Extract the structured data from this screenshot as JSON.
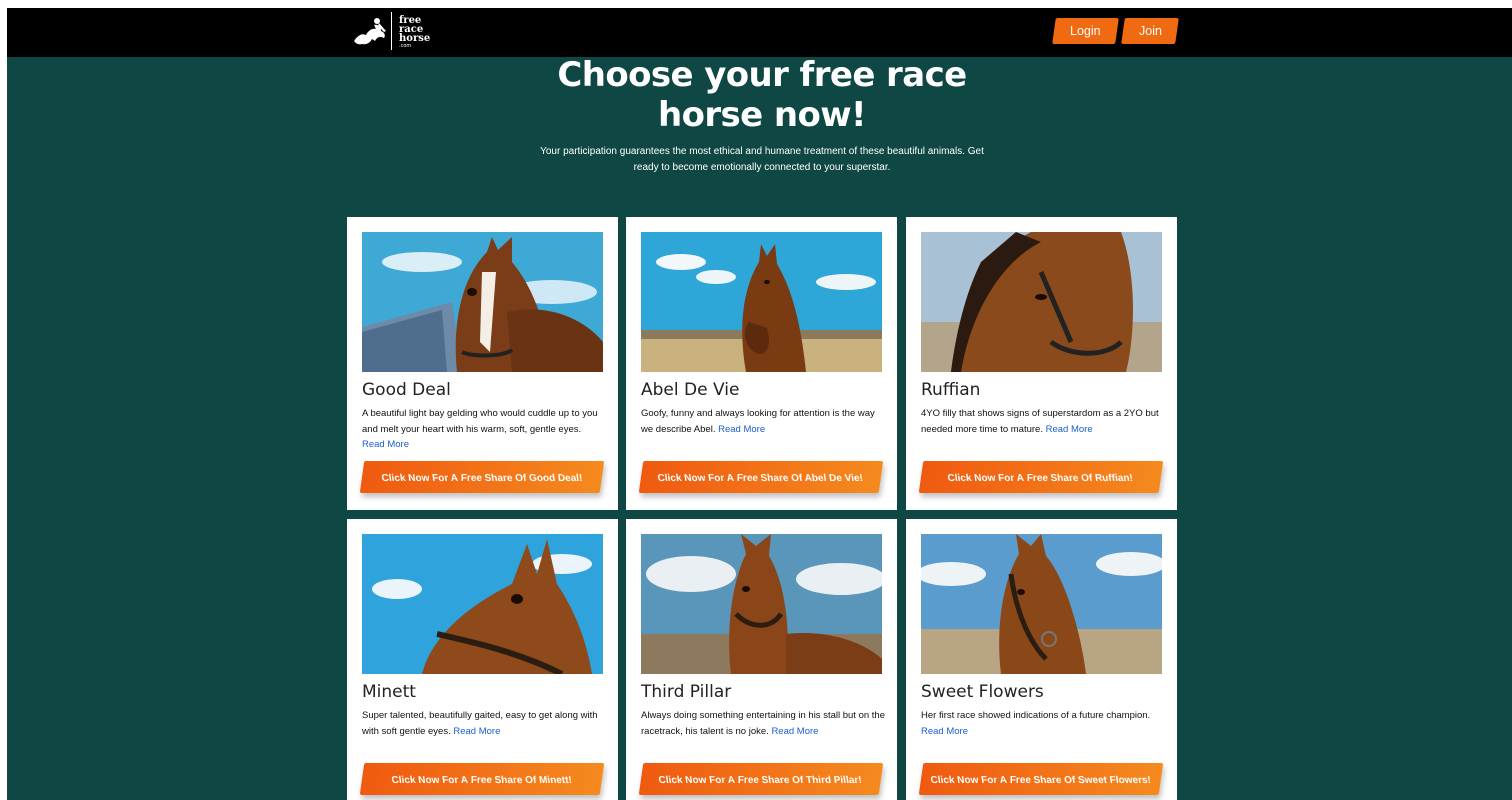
{
  "brand": {
    "logo_lines": [
      "free",
      "race",
      "horse"
    ],
    "logo_domain": ".com"
  },
  "nav": {
    "login_label": "Login",
    "join_label": "Join"
  },
  "hero": {
    "title": "Choose your free race horse now!",
    "subtitle": "Your participation guarantees the most ethical and humane treatment of these beautiful animals. Get ready to become emotionally connected to your superstar."
  },
  "cards": [
    {
      "name": "Good Deal",
      "desc": "A beautiful light bay gelding who would cuddle up to you and melt your heart with his warm, soft, gentle eyes.",
      "read_more": "Read More",
      "cta_prefix": "Click Now For A",
      "cta_bold": "Free",
      "cta_suffix": "Share Of Good Deal!"
    },
    {
      "name": "Abel De Vie",
      "desc": "Goofy, funny and always looking for attention is the way we describe Abel.",
      "read_more": "Read More",
      "cta_prefix": "Click Now For A",
      "cta_bold": "Free",
      "cta_suffix": "Share Of Abel De Vie!"
    },
    {
      "name": "Ruffian",
      "desc": "4YO filly that shows signs of superstardom as a 2YO but needed more time to mature.",
      "read_more": "Read More",
      "cta_prefix": "Click Now For A",
      "cta_bold": "Free",
      "cta_suffix": "Share Of Ruffian!"
    },
    {
      "name": "Minett",
      "desc": "Super talented, beautifully gaited, easy to get along with with soft gentle eyes.",
      "read_more": "Read More",
      "cta_prefix": "Click Now For A",
      "cta_bold": "Free",
      "cta_suffix": "Share Of Minett!"
    },
    {
      "name": "Third Pillar",
      "desc": "Always doing something entertaining in his stall but on the racetrack, his talent is no joke.",
      "read_more": "Read More",
      "cta_prefix": "Click Now For A",
      "cta_bold": "Free",
      "cta_suffix": "Share Of Third Pillar!"
    },
    {
      "name": "Sweet Flowers",
      "desc": "Her first race showed indications of a future champion.",
      "read_more": "Read More",
      "cta_prefix": "Click Now For A",
      "cta_bold": "Free",
      "cta_suffix": "Share Of Sweet Flowers!"
    }
  ],
  "colors": {
    "page_background": "#0f4744",
    "topbar": "#000000",
    "accent_orange": "#f06a12",
    "link_blue": "#1a5fd0"
  }
}
